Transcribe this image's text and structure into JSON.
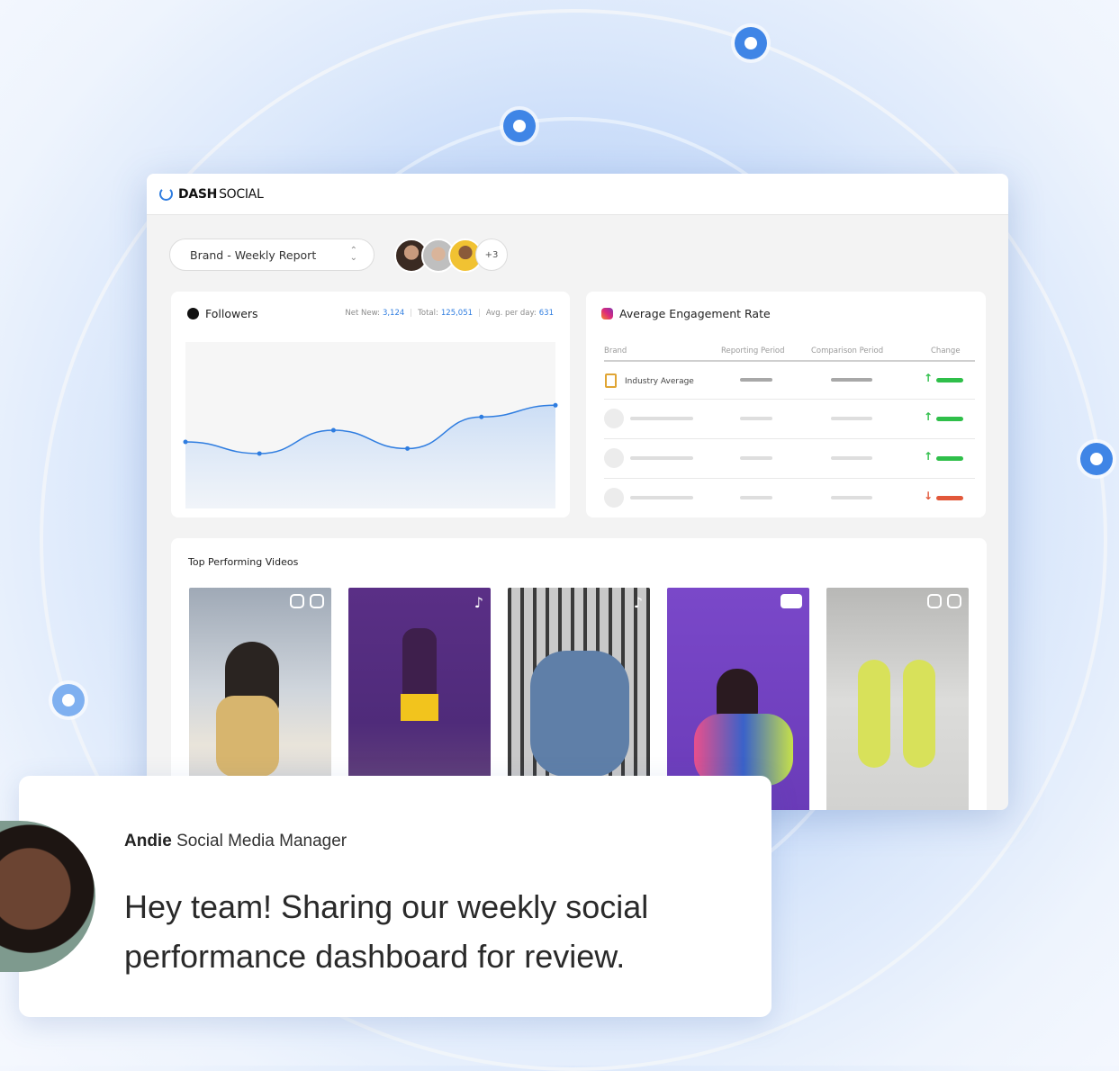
{
  "brand": {
    "bold": "DASH",
    "light": "SOCIAL"
  },
  "report_select": {
    "label": "Brand - Weekly Report"
  },
  "collaborators": {
    "more": "+3"
  },
  "followers": {
    "title": "Followers",
    "net_new_label": "Net New:",
    "net_new": "3,124",
    "total_label": "Total:",
    "total": "125,051",
    "avg_label": "Avg. per day:",
    "avg": "631"
  },
  "chart_data": {
    "type": "area",
    "title": "Followers",
    "x": [
      1,
      2,
      3,
      4,
      5,
      6
    ],
    "series": [
      {
        "values": [
          0.4,
          0.33,
          0.47,
          0.36,
          0.55,
          0.62
        ]
      }
    ],
    "ylim": [
      0,
      1
    ],
    "grid": false
  },
  "engagement": {
    "title": "Average Engagement Rate",
    "columns": [
      "Brand",
      "Reporting Period",
      "Comparison Period",
      "Change"
    ],
    "rows": [
      {
        "brand": "Industry Average",
        "change": "up"
      },
      {
        "brand": "",
        "change": "up"
      },
      {
        "brand": "",
        "change": "up"
      },
      {
        "brand": "",
        "change": "down"
      }
    ]
  },
  "videos": {
    "title": "Top Performing Videos"
  },
  "colors": {
    "accent": "#2f7de0",
    "up": "#2fbf4a",
    "down": "#e2583a"
  },
  "message": {
    "name": "Andie",
    "role": "Social Media Manager",
    "text": "Hey team! Sharing our weekly social performance dashboard for review."
  }
}
